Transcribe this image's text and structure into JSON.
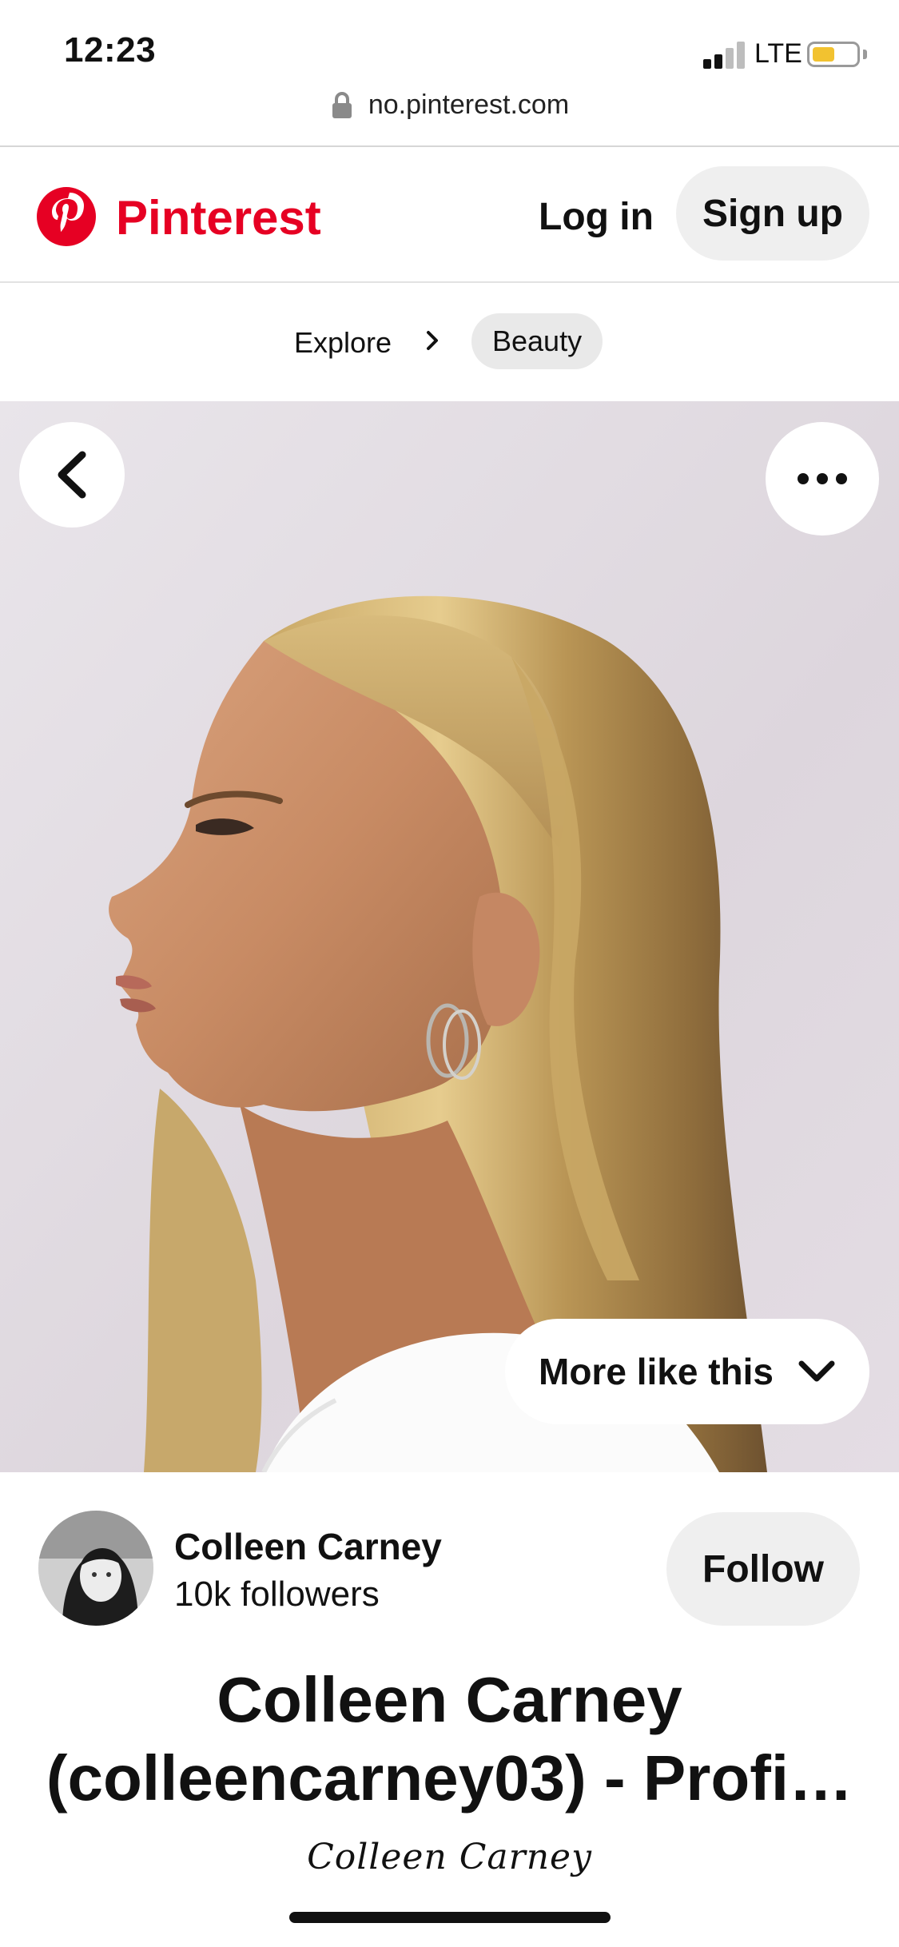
{
  "status_bar": {
    "time": "12:23",
    "network": "LTE",
    "battery_level": 0.45,
    "signal_bars_active": 2
  },
  "browser": {
    "url": "no.pinterest.com"
  },
  "header": {
    "brand": "Pinterest",
    "brand_color": "#e60023",
    "login_label": "Log in",
    "signup_label": "Sign up"
  },
  "breadcrumb": {
    "items": [
      {
        "label": "Explore"
      },
      {
        "label": "Beauty"
      }
    ]
  },
  "pin": {
    "more_like_this_label": "More like this",
    "icons": [
      "back-arrow-icon",
      "more-options-icon",
      "chevron-down-icon"
    ]
  },
  "creator": {
    "name": "Colleen Carney",
    "followers": "10k followers",
    "follow_label": "Follow"
  },
  "title": {
    "line1": "Colleen Carney",
    "line2": "(colleencarney03) - Profi…"
  },
  "signature": "Colleen Carney"
}
